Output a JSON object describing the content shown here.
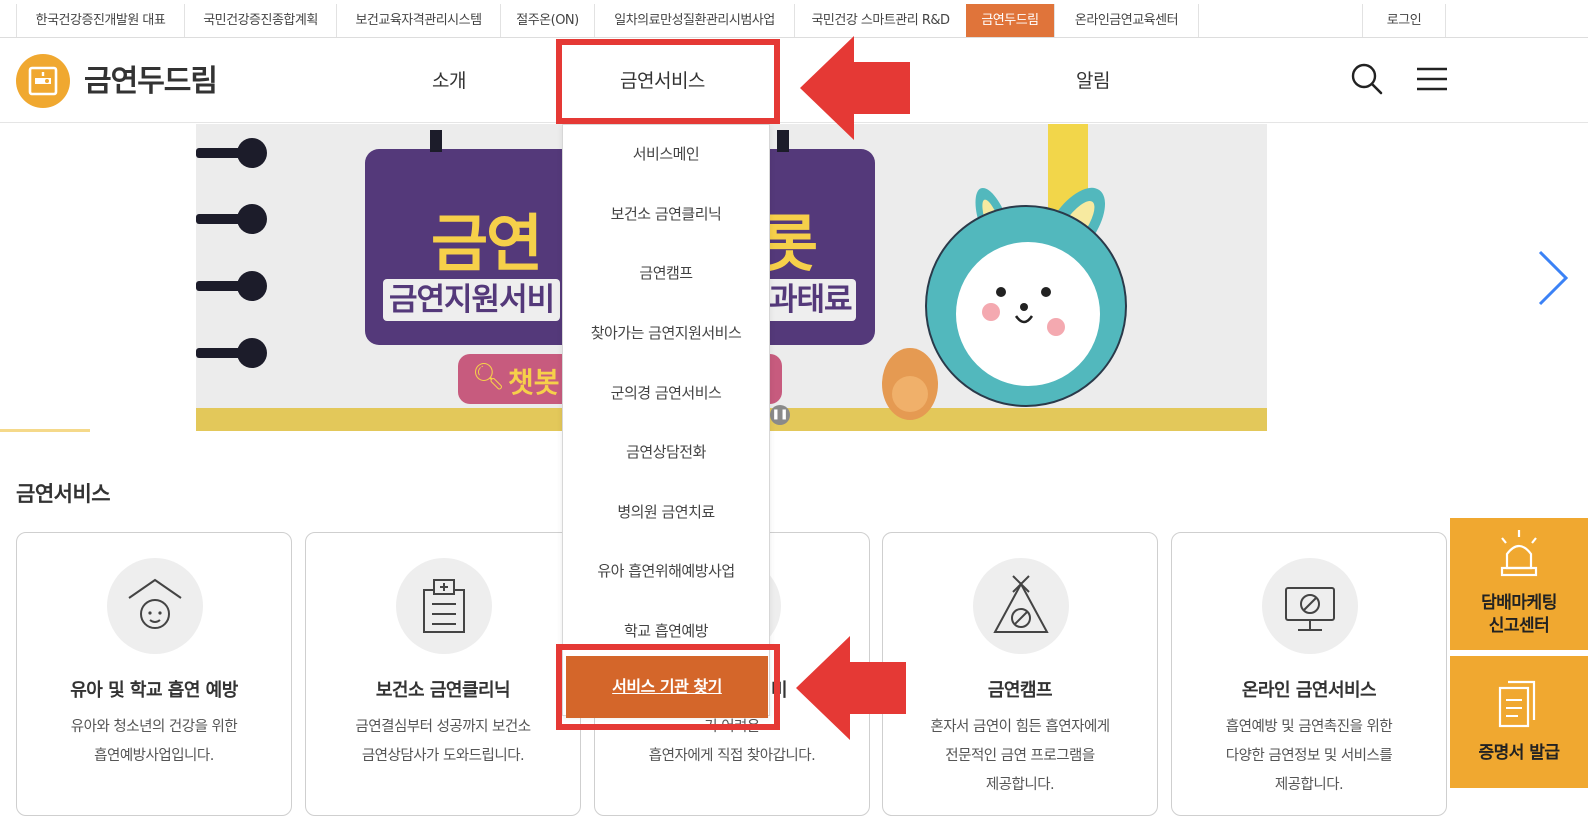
{
  "topbar": {
    "links": [
      "한국건강증진개발원 대표",
      "국민건강증진종합계획",
      "보건교육자격관리시스템",
      "절주온(ON)",
      "일차의료만성질환관리시범사업",
      "국민건강 스마트관리 R&D",
      "금연두드림",
      "온라인금연교육센터"
    ],
    "active_link": "금연두드림",
    "login": "로그인"
  },
  "header": {
    "logo_text": "금연두드림",
    "nav": {
      "intro": "소개",
      "service": "금연서비스",
      "notice": "알림"
    }
  },
  "banner": {
    "headline_part": "금연",
    "headline_suffix": "롯",
    "subline_left": "금연지원서비",
    "subline_right": "과태료",
    "chatbot_label": "챗봇"
  },
  "dropdown": {
    "items": [
      "서비스메인",
      "보건소 금연클리닉",
      "금연캠프",
      "찾아가는 금연지원서비스",
      "군의경 금연서비스",
      "금연상담전화",
      "병의원 금연치료",
      "유아 흡연위해예방사업",
      "학교 흡연예방"
    ],
    "highlight": "서비스 기관 찾기"
  },
  "section": {
    "title": "금연서비스"
  },
  "cards": [
    {
      "title": "유아 및 학교 흡연 예방",
      "desc": "유아와 청소년의 건강을 위한\n흡연예방사업입니다."
    },
    {
      "title": "보건소 금연클리닉",
      "desc": "금연결심부터 성공까지 보건소\n금연상담사가 도와드립니다."
    },
    {
      "title": "서비",
      "desc": "기 어려운\n흡연자에게 직접 찾아갑니다."
    },
    {
      "title": "금연캠프",
      "desc": "혼자서 금연이 힘든 흡연자에게\n전문적인 금연 프로그램을\n제공합니다."
    },
    {
      "title": "온라인 금연서비스",
      "desc": "흡연예방 및 금연촉진을 위한\n다양한 금연정보 및 서비스를\n제공합니다."
    }
  ],
  "side": {
    "report": "담배마케팅\n신고센터",
    "certificate": "증명서 발급"
  },
  "colors": {
    "accent": "#e0743a",
    "annotation_red": "#e53935",
    "side_orange": "#f0a830"
  }
}
